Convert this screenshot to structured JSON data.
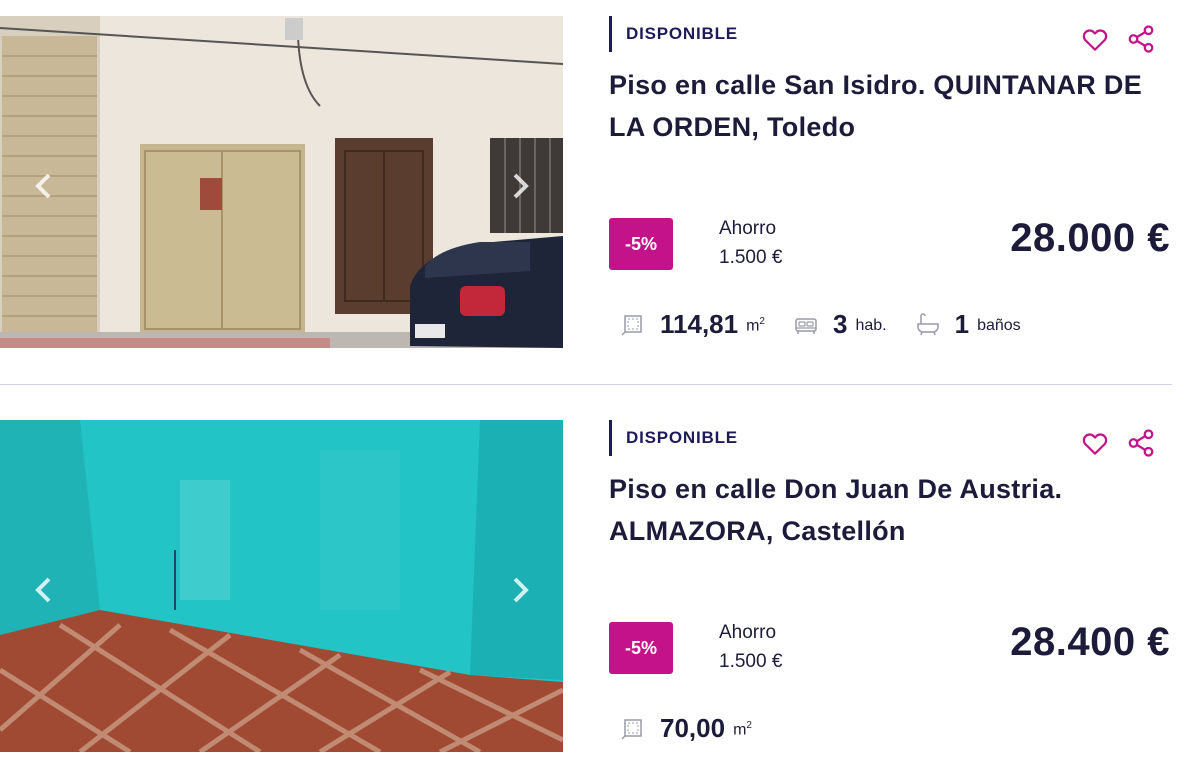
{
  "colors": {
    "accent": "#c4138a",
    "text": "#1d1b3a",
    "status_bar": "#1d1b5a",
    "divider": "#cfd0e6"
  },
  "icons": {
    "favorite": "heart-icon",
    "share": "share-icon",
    "area": "area-icon",
    "bedrooms": "bed-icon",
    "bathrooms": "bathtub-icon",
    "prev": "chevron-left-icon",
    "next": "chevron-right-icon"
  },
  "listings": [
    {
      "status": "DISPONIBLE",
      "title": "Piso en calle San Isidro. QUINTANAR DE LA ORDEN, Toledo",
      "discount": "-5%",
      "saving_label": "Ahorro",
      "saving_value": "1.500 €",
      "price": "28.000 €",
      "features": {
        "area_value": "114,81",
        "area_unit": "m",
        "area_exp": "2",
        "bedrooms_value": "3",
        "bedrooms_unit": "hab.",
        "bathrooms_value": "1",
        "bathrooms_unit": "baños"
      }
    },
    {
      "status": "DISPONIBLE",
      "title": "Piso en calle Don Juan De Austria. ALMAZORA, Castellón",
      "discount": "-5%",
      "saving_label": "Ahorro",
      "saving_value": "1.500 €",
      "price": "28.400 €",
      "features": {
        "area_value": "70,00",
        "area_unit": "m",
        "area_exp": "2"
      }
    }
  ]
}
